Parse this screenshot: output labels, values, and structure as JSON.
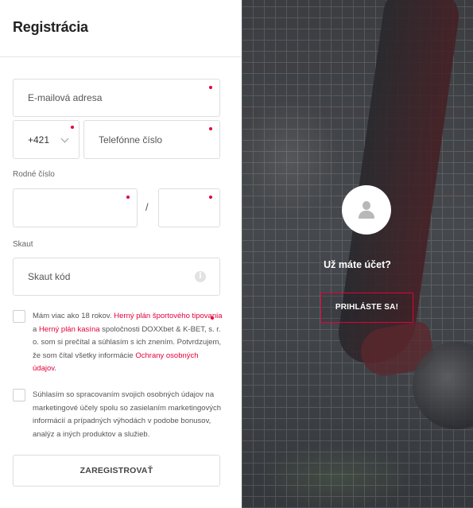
{
  "form": {
    "title": "Registrácia",
    "email": {
      "placeholder": "E-mailová adresa"
    },
    "phone": {
      "prefix": "+421",
      "placeholder": "Telefónne číslo"
    },
    "birth_number": {
      "label": "Rodné číslo",
      "separator": "/"
    },
    "scout": {
      "label": "Skaut",
      "placeholder": "Skaut kód"
    },
    "consent1": {
      "t1": "Mám viac ako 18 rokov. ",
      "l1": "Herný plán športového tipovania",
      "t2": " a ",
      "l2": "Herný plán kasína",
      "t3": " spoločnosti DOXXbet & K-BET, s. r. o. som si prečítal a súhlasím s ich znením. Potvrdzujem, že som čítal všetky informácie ",
      "l3": "Ochrany osobných údajov",
      "t4": "."
    },
    "consent2": {
      "text": "Súhlasím so spracovaním svojich osobných údajov na marketingové účely spolu so zasielaním marketingových informácií a prípadných výhodách v podobe bonusov, analýz a iných produktov a služieb."
    },
    "register_button": "ZAREGISTROVAŤ"
  },
  "side": {
    "question": "Už máte účet?",
    "login_button": "PRIHLÁSTE SA!"
  },
  "colors": {
    "accent": "#e4003a",
    "panel": "#3e4145"
  },
  "icons": {
    "info": "info-icon",
    "avatar": "user-icon",
    "chevron": "chevron-down-icon"
  }
}
